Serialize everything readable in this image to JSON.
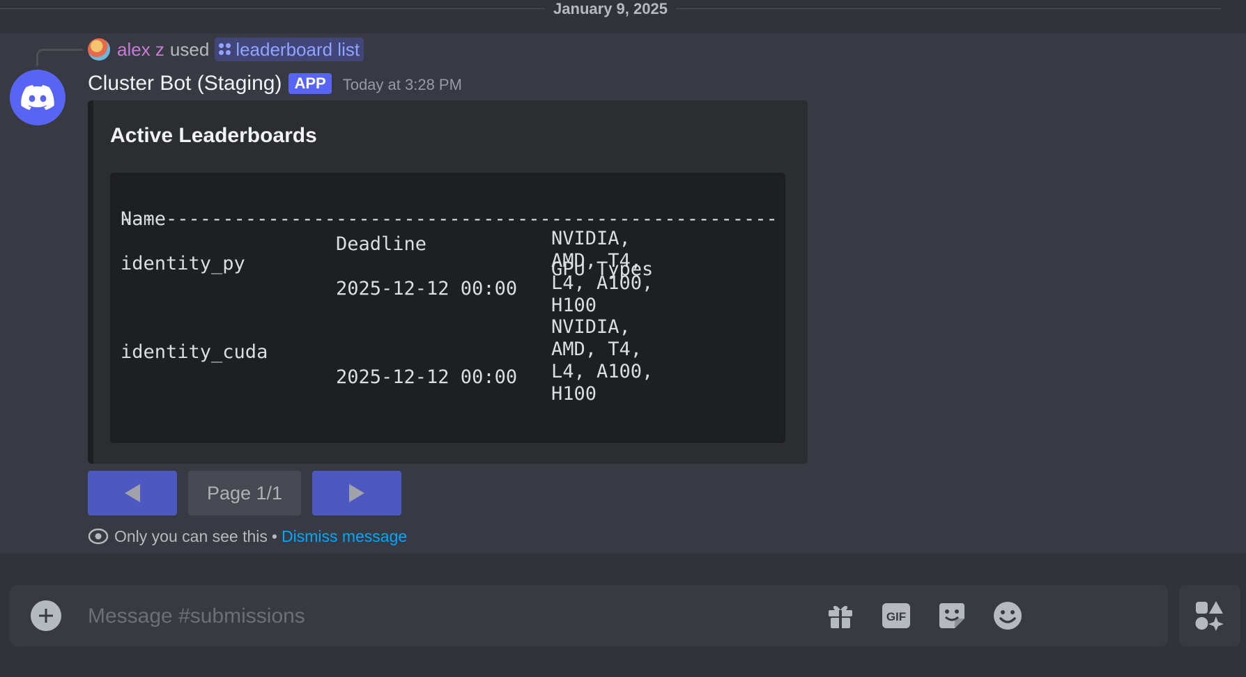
{
  "date_divider": "January 9, 2025",
  "reply": {
    "user": "alex z",
    "used_text": "used",
    "command": "leaderboard list"
  },
  "message": {
    "bot_name": "Cluster Bot (Staging)",
    "tag": "APP",
    "timestamp": "Today at 3:28 PM"
  },
  "embed": {
    "title": "Active Leaderboards",
    "table": {
      "headers": [
        "Name",
        "Deadline",
        "GPU Types"
      ],
      "separator": "---------------------------------------------------------------",
      "rows": [
        {
          "name": "identity_py",
          "deadline": "2025-12-12 00:00",
          "gpu_lines": [
            "NVIDIA,",
            "AMD, T4,",
            "L4, A100,",
            "H100"
          ]
        },
        {
          "name": "identity_cuda",
          "deadline": "2025-12-12 00:00",
          "gpu_lines": [
            "NVIDIA,",
            "AMD, T4,",
            "L4, A100,",
            "H100"
          ]
        }
      ]
    }
  },
  "pagination": {
    "page_label": "Page 1/1"
  },
  "ephemeral": {
    "notice": "Only you can see this",
    "dot": "•",
    "dismiss": "Dismiss message"
  },
  "composer": {
    "placeholder": "Message #submissions",
    "gif_label": "GIF"
  },
  "colors": {
    "background": "#313338",
    "highlight": "#373943",
    "blurple": "#5865f2",
    "link": "#00a8fc"
  }
}
